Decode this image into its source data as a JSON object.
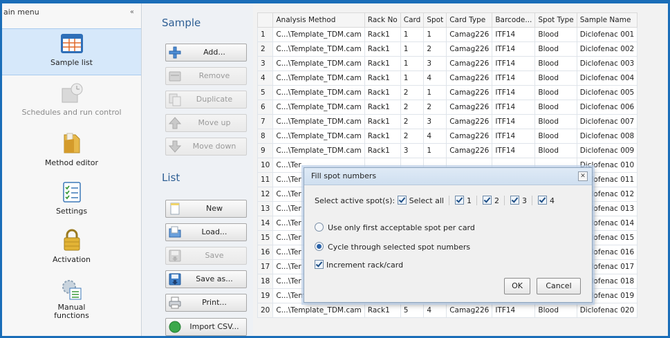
{
  "main_menu": {
    "title": "ain menu",
    "collapse_glyph": "«",
    "items": [
      {
        "label": "Sample list",
        "icon": "sample-list-icon",
        "selected": true,
        "enabled": true
      },
      {
        "label": "Schedules and run control",
        "icon": "schedule-icon",
        "selected": false,
        "enabled": false
      },
      {
        "label": "Method editor",
        "icon": "folder-icon",
        "selected": false,
        "enabled": true
      },
      {
        "label": "Settings",
        "icon": "settings-checklist-icon",
        "selected": false,
        "enabled": true
      },
      {
        "label": "Activation",
        "icon": "padlock-icon",
        "selected": false,
        "enabled": true
      },
      {
        "label": "Manual functions",
        "icon": "manual-functions-icon",
        "selected": false,
        "enabled": true
      }
    ]
  },
  "sample_section": {
    "title": "Sample",
    "buttons": {
      "add": "Add...",
      "remove": "Remove",
      "duplicate": "Duplicate",
      "move_up": "Move up",
      "move_down": "Move down"
    }
  },
  "list_section": {
    "title": "List",
    "buttons": {
      "new": "New",
      "load": "Load...",
      "save": "Save",
      "save_as": "Save as...",
      "print": "Print...",
      "import_csv": "Import CSV..."
    }
  },
  "grid": {
    "columns": [
      "",
      "Analysis Method",
      "Rack No",
      "Card",
      "Spot",
      "Card Type",
      "Barcode...",
      "Spot Type",
      "Sample Name"
    ],
    "rows": [
      [
        "1",
        "C...\\Template_TDM.cam",
        "Rack1",
        "1",
        "1",
        "Camag226",
        "ITF14",
        "Blood",
        "Diclofenac 001"
      ],
      [
        "2",
        "C...\\Template_TDM.cam",
        "Rack1",
        "1",
        "2",
        "Camag226",
        "ITF14",
        "Blood",
        "Diclofenac 002"
      ],
      [
        "3",
        "C...\\Template_TDM.cam",
        "Rack1",
        "1",
        "3",
        "Camag226",
        "ITF14",
        "Blood",
        "Diclofenac 003"
      ],
      [
        "4",
        "C...\\Template_TDM.cam",
        "Rack1",
        "1",
        "4",
        "Camag226",
        "ITF14",
        "Blood",
        "Diclofenac 004"
      ],
      [
        "5",
        "C...\\Template_TDM.cam",
        "Rack1",
        "2",
        "1",
        "Camag226",
        "ITF14",
        "Blood",
        "Diclofenac 005"
      ],
      [
        "6",
        "C...\\Template_TDM.cam",
        "Rack1",
        "2",
        "2",
        "Camag226",
        "ITF14",
        "Blood",
        "Diclofenac 006"
      ],
      [
        "7",
        "C...\\Template_TDM.cam",
        "Rack1",
        "2",
        "3",
        "Camag226",
        "ITF14",
        "Blood",
        "Diclofenac 007"
      ],
      [
        "8",
        "C...\\Template_TDM.cam",
        "Rack1",
        "2",
        "4",
        "Camag226",
        "ITF14",
        "Blood",
        "Diclofenac 008"
      ],
      [
        "9",
        "C...\\Template_TDM.cam",
        "Rack1",
        "3",
        "1",
        "Camag226",
        "ITF14",
        "Blood",
        "Diclofenac 009"
      ],
      [
        "10",
        "C...\\Ter",
        "",
        "",
        "",
        "",
        "",
        "",
        "Diclofenac 010"
      ],
      [
        "11",
        "C...\\Ter",
        "",
        "",
        "",
        "",
        "",
        "",
        "Diclofenac 011"
      ],
      [
        "12",
        "C...\\Ter",
        "",
        "",
        "",
        "",
        "",
        "",
        "Diclofenac 012"
      ],
      [
        "13",
        "C...\\Ter",
        "",
        "",
        "",
        "",
        "",
        "",
        "Diclofenac 013"
      ],
      [
        "14",
        "C...\\Ter",
        "",
        "",
        "",
        "",
        "",
        "",
        "Diclofenac 014"
      ],
      [
        "15",
        "C...\\Ter",
        "",
        "",
        "",
        "",
        "",
        "",
        "Diclofenac 015"
      ],
      [
        "16",
        "C...\\Ter",
        "",
        "",
        "",
        "",
        "",
        "",
        "Diclofenac 016"
      ],
      [
        "17",
        "C...\\Ter",
        "",
        "",
        "",
        "",
        "",
        "",
        "Diclofenac 017"
      ],
      [
        "18",
        "C...\\Ter",
        "",
        "",
        "",
        "",
        "",
        "",
        "Diclofenac 018"
      ],
      [
        "19",
        "C...\\Template_TDM.cam",
        "Rack1",
        "5",
        "3",
        "Camag226",
        "ITF14",
        "Blood",
        "Diclofenac 019"
      ],
      [
        "20",
        "C...\\Template_TDM.cam",
        "Rack1",
        "5",
        "4",
        "Camag226",
        "ITF14",
        "Blood",
        "Diclofenac 020"
      ]
    ]
  },
  "dialog": {
    "title": "Fill spot numbers",
    "close_glyph": "✕",
    "select_label": "Select active spot(s):",
    "select_all": "Select all",
    "spots": [
      "1",
      "2",
      "3",
      "4"
    ],
    "option_first": "Use only first acceptable spot per card",
    "option_cycle": "Cycle through selected spot numbers",
    "increment": "Increment rack/card",
    "ok": "OK",
    "cancel": "Cancel"
  }
}
